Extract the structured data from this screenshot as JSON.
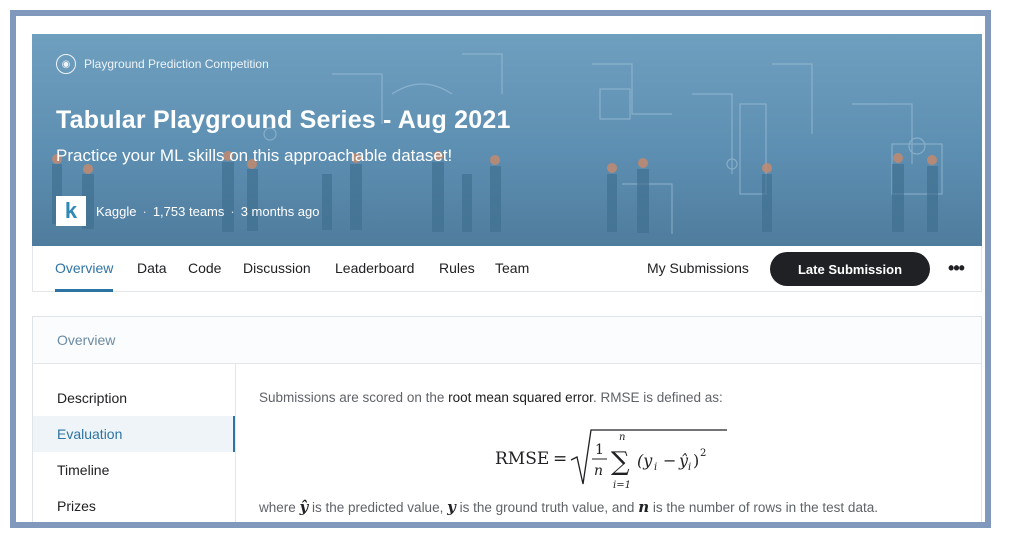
{
  "banner": {
    "eyebrow": "Playground Prediction Competition",
    "title": "Tabular Playground Series - Aug 2021",
    "subtitle": "Practice your ML skills on this approachable dataset!",
    "host": "Kaggle",
    "teams": "1,753 teams",
    "time": "3 months ago",
    "logo_letter": "k",
    "separator": "·"
  },
  "nav": {
    "tabs": [
      "Overview",
      "Data",
      "Code",
      "Discussion",
      "Leaderboard",
      "Rules",
      "Team"
    ],
    "my_submissions": "My Submissions",
    "late_submission": "Late Submission",
    "more": "•••"
  },
  "panel": {
    "heading": "Overview",
    "sidebar": [
      "Description",
      "Evaluation",
      "Timeline",
      "Prizes"
    ],
    "content": {
      "line1_pre": "Submissions are scored on the ",
      "line1_em": "root mean squared error",
      "line1_post": ". RMSE is defined as:",
      "formula_label": "RMSE",
      "line2_a": "where ",
      "var_yhat": "ŷ",
      "line2_b": " is the predicted value, ",
      "var_y": "y",
      "line2_c": " is the ground truth value, and ",
      "var_n": "n",
      "line2_d": " is the number of rows in the test data."
    }
  },
  "colors": {
    "accent": "#2e74a3",
    "button_dark": "#202124",
    "frame": "#7f98bb",
    "banner": "#5d8fb2"
  }
}
